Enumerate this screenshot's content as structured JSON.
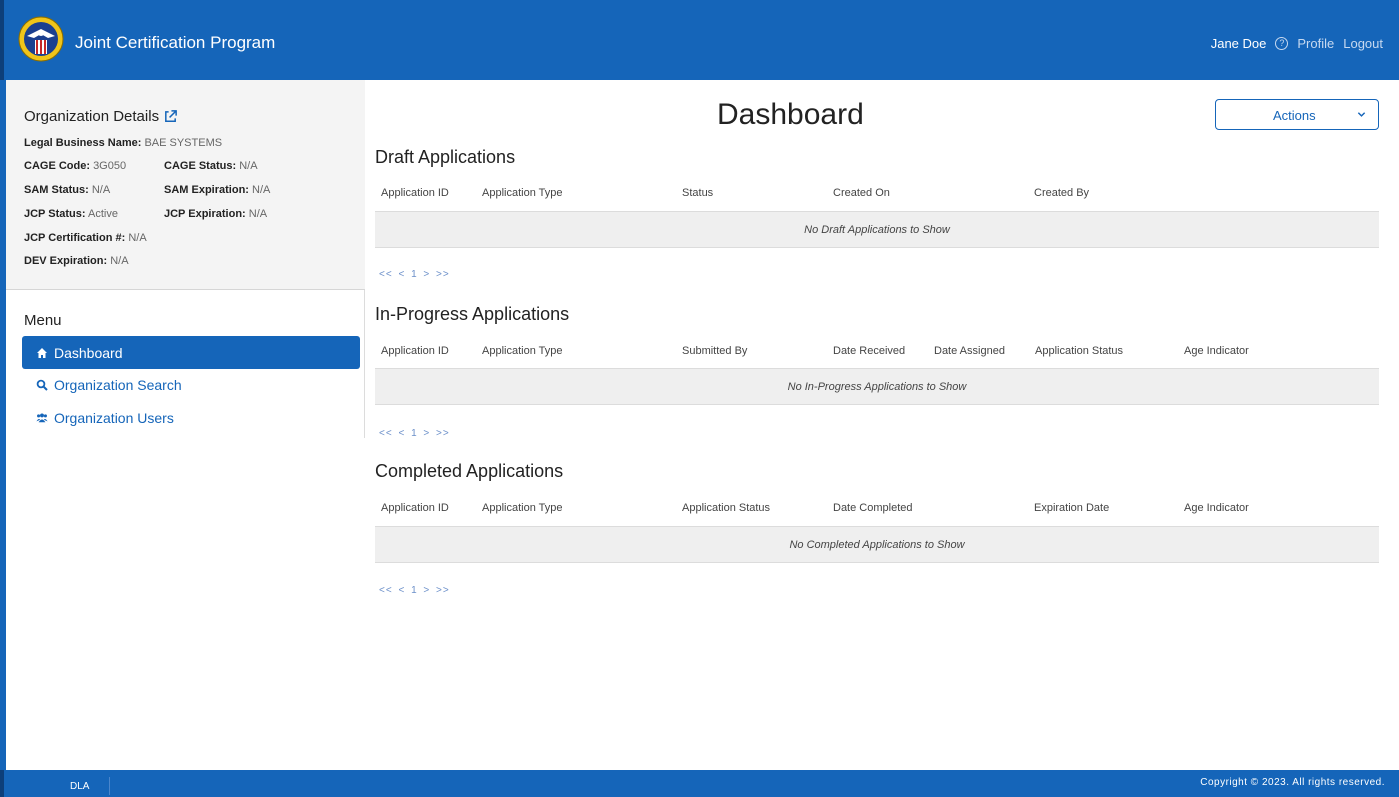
{
  "header": {
    "app_title": "Joint Certification Program",
    "user_name": "Jane Doe",
    "help_glyph": "?",
    "profile_label": "Profile",
    "logout_label": "Logout"
  },
  "org": {
    "title": "Organization Details",
    "legal_name_label": "Legal Business Name:",
    "legal_name_value": "BAE SYSTEMS",
    "cage_code_label": "CAGE Code:",
    "cage_code_value": "3G050",
    "cage_status_label": "CAGE Status:",
    "cage_status_value": "N/A",
    "sam_status_label": "SAM Status:",
    "sam_status_value": "N/A",
    "sam_exp_label": "SAM Expiration:",
    "sam_exp_value": "N/A",
    "jcp_status_label": "JCP Status:",
    "jcp_status_value": "Active",
    "jcp_exp_label": "JCP Expiration:",
    "jcp_exp_value": "N/A",
    "jcp_cert_label": "JCP Certification #:",
    "jcp_cert_value": "N/A",
    "dev_exp_label": "DEV Expiration:",
    "dev_exp_value": "N/A"
  },
  "menu": {
    "title": "Menu",
    "items": [
      {
        "label": "Dashboard",
        "icon": "home-icon"
      },
      {
        "label": "Organization Search",
        "icon": "search-icon"
      },
      {
        "label": "Organization Users",
        "icon": "users-icon"
      }
    ]
  },
  "main": {
    "page_title": "Dashboard",
    "actions_label": "Actions",
    "draft": {
      "title": "Draft Applications",
      "columns": [
        "Application ID",
        "Application Type",
        "Status",
        "Created On",
        "Created By"
      ],
      "empty": "No Draft Applications to Show",
      "pager": "<< < 1 > >>"
    },
    "in_progress": {
      "title": "In-Progress Applications",
      "columns": [
        "Application ID",
        "Application Type",
        "Submitted By",
        "Date Received",
        "Date Assigned",
        "Application Status",
        "Age Indicator"
      ],
      "empty": "No In-Progress Applications to Show",
      "pager": "<< < 1 > >>"
    },
    "completed": {
      "title": "Completed Applications",
      "columns": [
        "Application ID",
        "Application Type",
        "Application Status",
        "Date Completed",
        "Expiration Date",
        "Age Indicator"
      ],
      "empty": "No Completed Applications to Show",
      "pager": "<< < 1 > >>"
    }
  },
  "footer": {
    "left": "DLA",
    "copyright": "Copyright © 2023. All rights reserved."
  },
  "colors": {
    "brand_blue": "#1565b9",
    "row_gray": "#efefef",
    "sidebar_gray": "#f4f4f4"
  }
}
